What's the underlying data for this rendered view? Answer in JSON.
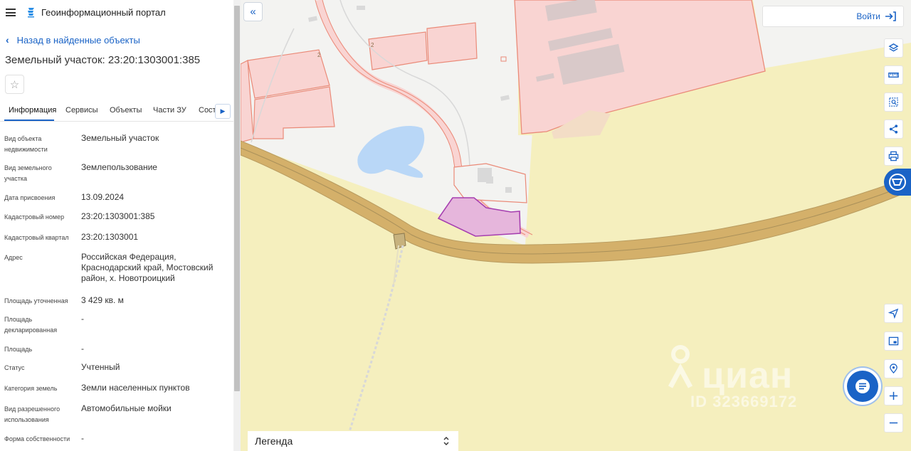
{
  "app": {
    "title": "Геоинформационный портал"
  },
  "nav": {
    "back_label": "Назад в найденные объекты"
  },
  "object": {
    "title": "Земельный участок: 23:20:1303001:385"
  },
  "tabs": [
    {
      "label": "Информация",
      "active": true
    },
    {
      "label": "Сервисы"
    },
    {
      "label": "Объекты"
    },
    {
      "label": "Части ЗУ"
    },
    {
      "label": "Соста"
    }
  ],
  "info": [
    {
      "label": "Вид объекта недвижимости",
      "value": "Земельный участок"
    },
    {
      "label": "Вид земельного участка",
      "value": "Землепользование"
    },
    {
      "label": "Дата присвоения",
      "value": "13.09.2024"
    },
    {
      "label": "Кадастровый номер",
      "value": "23:20:1303001:385"
    },
    {
      "label": "Кадастровый квартал",
      "value": "23:20:1303001"
    },
    {
      "label": "Адрес",
      "value": "Российская Федерация, Краснодарский край, Мостовский район, х. Новотроицкий"
    },
    {
      "label": "Площадь уточненная",
      "value": "3 429 кв. м"
    },
    {
      "label": "Площадь декларированная",
      "value": "-"
    },
    {
      "label": "Площадь",
      "value": "-"
    },
    {
      "label": "Статус",
      "value": "Учтенный"
    },
    {
      "label": "Категория земель",
      "value": "Земли населенных пунктов"
    },
    {
      "label": "Вид разрешенного использования",
      "value": "Автомобильные мойки"
    },
    {
      "label": "Форма собственности",
      "value": "-"
    }
  ],
  "map": {
    "login_label": "Войти",
    "legend_label": "Легенда",
    "building_numbers": [
      "2",
      "2"
    ],
    "watermark": {
      "brand": "циан",
      "id": "ID 323669172"
    },
    "tools": [
      "layers-icon",
      "ruler-icon",
      "area-select-icon",
      "share-icon",
      "print-icon",
      "pkk-logo-icon",
      "locate-icon",
      "minimap-icon",
      "geo-search-icon",
      "zoom-in-icon",
      "zoom-out-icon"
    ]
  },
  "colors": {
    "accent": "#1a63c6",
    "field": "#f5efbe",
    "highlight_parcel": "#e6b6dc",
    "parcel_border": "#e98a7a",
    "road": "#d4b06a",
    "water": "#b9d7f7"
  }
}
